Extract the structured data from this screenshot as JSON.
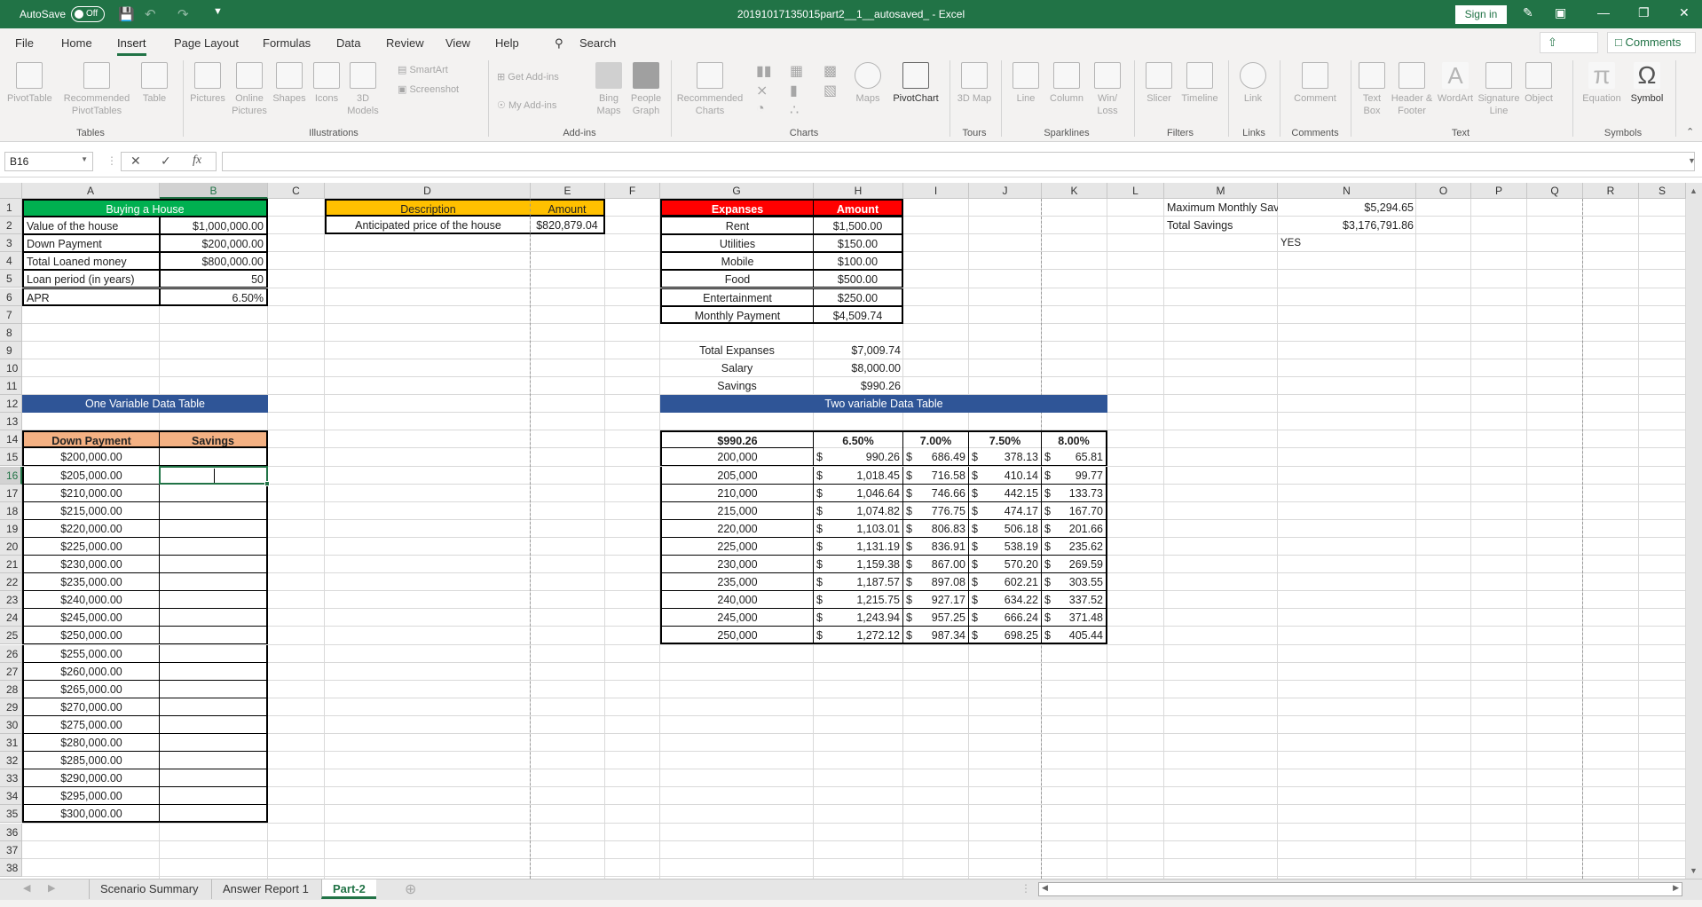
{
  "titlebar": {
    "autosave_label": "AutoSave",
    "autosave_state": "Off",
    "title": "20191017135015part2__1__autosaved_  -  Excel",
    "signin_label": "Sign in"
  },
  "ribbon_tabs": [
    "File",
    "Home",
    "Insert",
    "Page Layout",
    "Formulas",
    "Data",
    "Review",
    "View",
    "Help"
  ],
  "active_tab": "Insert",
  "search_label": "Search",
  "share_label": "Share",
  "comments_label": "Comments",
  "ribbon": {
    "tables": {
      "label": "Tables",
      "items": [
        "PivotTable",
        "Recommended PivotTables",
        "Table"
      ]
    },
    "illustrations": {
      "label": "Illustrations",
      "items": [
        "Pictures",
        "Online Pictures",
        "Shapes",
        "Icons",
        "3D Models"
      ],
      "small": [
        "SmartArt",
        "Screenshot"
      ]
    },
    "addins": {
      "label": "Add-ins",
      "small": [
        "Get Add-ins",
        "My Add-ins"
      ],
      "items": [
        "Bing Maps",
        "People Graph"
      ]
    },
    "charts": {
      "label": "Charts",
      "items": [
        "Recommended Charts",
        "Maps",
        "PivotChart"
      ]
    },
    "tours": {
      "label": "Tours",
      "items": [
        "3D Map"
      ]
    },
    "sparklines": {
      "label": "Sparklines",
      "items": [
        "Line",
        "Column",
        "Win/ Loss"
      ]
    },
    "filters": {
      "label": "Filters",
      "items": [
        "Slicer",
        "Timeline"
      ]
    },
    "links": {
      "label": "Links",
      "items": [
        "Link"
      ]
    },
    "comments": {
      "label": "Comments",
      "items": [
        "Comment"
      ]
    },
    "text": {
      "label": "Text",
      "items": [
        "Text Box",
        "Header & Footer",
        "WordArt",
        "Signature Line",
        "Object"
      ]
    },
    "symbols": {
      "label": "Symbols",
      "items": [
        "Equation",
        "Symbol"
      ]
    }
  },
  "formula_bar": {
    "name_box": "B16",
    "formula": ""
  },
  "columns": [
    "A",
    "B",
    "C",
    "D",
    "E",
    "F",
    "G",
    "H",
    "I",
    "J",
    "K",
    "L",
    "M",
    "N",
    "O",
    "P",
    "Q",
    "R",
    "S"
  ],
  "selected_cell": "B16",
  "buying_house": {
    "title": "Buying  a House",
    "rows": [
      {
        "label": "Value of the house",
        "value": "$1,000,000.00"
      },
      {
        "label": "Down Payment",
        "value": "$200,000.00"
      },
      {
        "label": "Total Loaned money",
        "value": "$800,000.00"
      },
      {
        "label": "Loan period (in years)",
        "value": "50"
      },
      {
        "label": "APR",
        "value": "6.50%"
      }
    ]
  },
  "description_table": {
    "headers": [
      "Description",
      "Amount"
    ],
    "row": [
      "Anticipated price of the house",
      "$820,879.04"
    ]
  },
  "expenses_table": {
    "headers": [
      "Expanses",
      "Amount"
    ],
    "rows": [
      [
        "Rent",
        "$1,500.00"
      ],
      [
        "Utilities",
        "$150.00"
      ],
      [
        "Mobile",
        "$100.00"
      ],
      [
        "Food",
        "$500.00"
      ],
      [
        "Entertainment",
        "$250.00"
      ],
      [
        "Monthly Payment",
        "$4,509.74"
      ]
    ]
  },
  "summary": [
    [
      "Total Expanses",
      "$7,009.74"
    ],
    [
      "Salary",
      "$8,000.00"
    ],
    [
      "Savings",
      "$990.26"
    ]
  ],
  "savings_info": {
    "max_label": "Maximum Monthly Savings",
    "max_value": "$5,294.65",
    "total_label": "Total Savings",
    "total_value": "$3,176,791.86",
    "flag": "YES"
  },
  "one_var": {
    "title": "One Variable Data Table",
    "headers": [
      "Down Payment",
      "Savings"
    ],
    "rows": [
      "$200,000.00",
      "$205,000.00",
      "$210,000.00",
      "$215,000.00",
      "$220,000.00",
      "$225,000.00",
      "$230,000.00",
      "$235,000.00",
      "$240,000.00",
      "$245,000.00",
      "$250,000.00",
      "$255,000.00",
      "$260,000.00",
      "$265,000.00",
      "$270,000.00",
      "$275,000.00",
      "$280,000.00",
      "$285,000.00",
      "$290,000.00",
      "$295,000.00",
      "$300,000.00"
    ]
  },
  "two_var": {
    "title": "Two variable Data Table",
    "corner": "$990.26",
    "rates": [
      "6.50%",
      "7.00%",
      "7.50%",
      "8.00%"
    ],
    "rows": [
      {
        "dp": "200,000",
        "v": [
          "990.26",
          "686.49",
          "378.13",
          "65.81"
        ]
      },
      {
        "dp": "205,000",
        "v": [
          "1,018.45",
          "716.58",
          "410.14",
          "99.77"
        ]
      },
      {
        "dp": "210,000",
        "v": [
          "1,046.64",
          "746.66",
          "442.15",
          "133.73"
        ]
      },
      {
        "dp": "215,000",
        "v": [
          "1,074.82",
          "776.75",
          "474.17",
          "167.70"
        ]
      },
      {
        "dp": "220,000",
        "v": [
          "1,103.01",
          "806.83",
          "506.18",
          "201.66"
        ]
      },
      {
        "dp": "225,000",
        "v": [
          "1,131.19",
          "836.91",
          "538.19",
          "235.62"
        ]
      },
      {
        "dp": "230,000",
        "v": [
          "1,159.38",
          "867.00",
          "570.20",
          "269.59"
        ]
      },
      {
        "dp": "235,000",
        "v": [
          "1,187.57",
          "897.08",
          "602.21",
          "303.55"
        ]
      },
      {
        "dp": "240,000",
        "v": [
          "1,215.75",
          "927.17",
          "634.22",
          "337.52"
        ]
      },
      {
        "dp": "245,000",
        "v": [
          "1,243.94",
          "957.25",
          "666.24",
          "371.48"
        ]
      },
      {
        "dp": "250,000",
        "v": [
          "1,272.12",
          "987.34",
          "698.25",
          "405.44"
        ]
      }
    ],
    "currency": "$"
  },
  "sheet_tabs": [
    "Scenario Summary",
    "Answer Report 1",
    "Part-2"
  ],
  "active_sheet": "Part-2",
  "colors": {
    "green": "#217346",
    "buying_header": "#00b050",
    "desc_header": "#ffc000",
    "exp_header": "#ff0000",
    "blue_band": "#2f5597",
    "orange_header": "#f4b183"
  }
}
